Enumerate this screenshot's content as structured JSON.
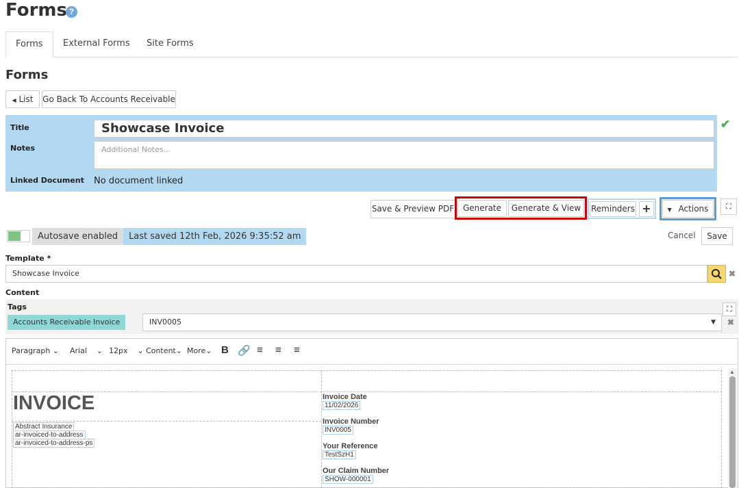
{
  "header": {
    "title": "Forms",
    "help": "?"
  },
  "tabs": [
    {
      "label": "Forms"
    },
    {
      "label": "External Forms"
    },
    {
      "label": "Site Forms"
    }
  ],
  "section_title": "Forms",
  "nav": {
    "list": "List",
    "back": "Go Back To Accounts Receivable"
  },
  "panel": {
    "title_label": "Title",
    "title_value": "Showcase Invoice",
    "notes_label": "Notes",
    "notes_placeholder": "Additional Notes...",
    "linked_label": "Linked Document",
    "linked_value": "No document linked"
  },
  "actions": {
    "save_preview": "Save & Preview PDF",
    "generate": "Generate",
    "generate_view": "Generate & View",
    "reminders": "Reminders",
    "add": "+",
    "actions": "Actions"
  },
  "status": {
    "autosave": "Autosave enabled",
    "last_saved": "Last saved 12th Feb, 2026 9:35:52 am",
    "cancel": "Cancel",
    "save": "Save"
  },
  "template": {
    "label": "Template *",
    "value": "Showcase Invoice"
  },
  "content_label": "Content",
  "tags": {
    "label": "Tags",
    "chip": "Accounts Receivable Invoice",
    "selected": "INV0005"
  },
  "toolbar": {
    "paragraph": "Paragraph",
    "font": "Arial",
    "size": "12px",
    "content": "Content",
    "more": "More"
  },
  "document": {
    "heading": "INVOICE",
    "address_lines": [
      "Abstract Insurance",
      "ar-invoiced-to-address",
      "ar-invoiced-to-address-ps"
    ],
    "fields": [
      {
        "label": "Invoice Date",
        "value": "11/02/2026"
      },
      {
        "label": "Invoice Number",
        "value": "INV0005"
      },
      {
        "label": "Your Reference",
        "value": "TestSzH1"
      },
      {
        "label": "Our Claim Number",
        "value": "SHOW-000001"
      }
    ]
  },
  "colors": {
    "panel": "#b3d9f2",
    "highlight_red": "#cc0000",
    "highlight_blue": "#5b9bd5",
    "tag_chip": "#8ed8d8"
  }
}
